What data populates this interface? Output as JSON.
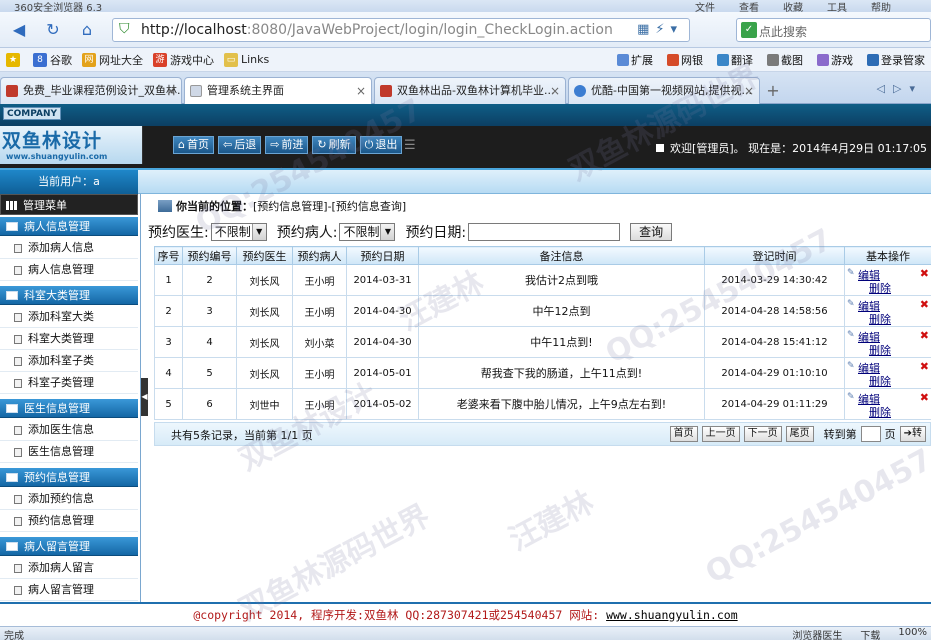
{
  "browser": {
    "title": "360安全浏览器 6.3",
    "menu": [
      "文件",
      "查看",
      "收藏",
      "工具",
      "帮助"
    ],
    "url_host": "http://localhost",
    "url_path": ":8080/JavaWebProject/login/login_CheckLogin.action",
    "search_placeholder": "点此搜索",
    "favorites": [
      {
        "label": "谷歌",
        "color": "#3b6fd1"
      },
      {
        "label": "网址大全",
        "color": "#e3a21b"
      },
      {
        "label": "游戏中心",
        "color": "#d9412a"
      },
      {
        "label": "Links",
        "color": "#e2c04b"
      }
    ],
    "tools": [
      "扩展",
      "网银",
      "翻译",
      "截图",
      "游戏",
      "登录管家"
    ],
    "tabs": [
      {
        "label": "免费_毕业课程范例设计_双鱼林...",
        "color": "#c0392b"
      },
      {
        "label": "管理系统主界面",
        "color": "#cfd8e6"
      },
      {
        "label": "双鱼林出品-双鱼林计算机毕业...",
        "color": "#c0392b"
      },
      {
        "label": "优酷-中国第一视频网站,提供视...",
        "color": "#3c7dd1"
      }
    ],
    "status_left": "完成",
    "status_right": [
      "浏览器医生",
      "下载",
      "100%"
    ]
  },
  "header": {
    "company": "COMPANY",
    "logo_main": "双鱼林设计",
    "logo_sub": "www.shuangyulin.com",
    "buttons": [
      {
        "icon": "⌂",
        "label": "首页"
      },
      {
        "icon": "⇦",
        "label": "后退"
      },
      {
        "icon": "⇨",
        "label": "前进"
      },
      {
        "icon": "↻",
        "label": "刷新"
      },
      {
        "icon": "⏻",
        "label": "退出"
      }
    ],
    "welcome": "欢迎[管理员]。  现在是：2014年4月29日 01:17:05"
  },
  "sidebar": {
    "current_user": "当前用户：a",
    "menu_title": "管理菜单",
    "groups": [
      {
        "title": "病人信息管理",
        "items": [
          "添加病人信息",
          "病人信息管理"
        ]
      },
      {
        "title": "科室大类管理",
        "items": [
          "添加科室大类",
          "科室大类管理",
          "添加科室子类",
          "科室子类管理"
        ]
      },
      {
        "title": "医生信息管理",
        "items": [
          "添加医生信息",
          "医生信息管理"
        ]
      },
      {
        "title": "预约信息管理",
        "items": [
          "添加预约信息",
          "预约信息管理"
        ]
      },
      {
        "title": "病人留言管理",
        "items": [
          "添加病人留言",
          "病人留言管理"
        ]
      }
    ]
  },
  "main": {
    "breadcrumb_label": "你当前的位置：",
    "breadcrumb_path": "[预约信息管理]-[预约信息查询]",
    "filters": {
      "doctor_label": "预约医生:",
      "doctor_value": "不限制",
      "patient_label": "预约病人:",
      "patient_value": "不限制",
      "date_label": "预约日期:",
      "date_value": "",
      "search_button": "查询"
    },
    "columns": [
      "序号",
      "预约编号",
      "预约医生",
      "预约病人",
      "预约日期",
      "备注信息",
      "登记时间",
      "基本操作"
    ],
    "rows": [
      {
        "seq": "1",
        "id": "2",
        "doctor": "刘长风",
        "patient": "王小明",
        "date": "2014-03-31",
        "note": "我估计2点到哦",
        "reg": "2014-03-29 14:30:42"
      },
      {
        "seq": "2",
        "id": "3",
        "doctor": "刘长风",
        "patient": "王小明",
        "date": "2014-04-30",
        "note": "中午12点到",
        "reg": "2014-04-28 14:58:56"
      },
      {
        "seq": "3",
        "id": "4",
        "doctor": "刘长风",
        "patient": "刘小菜",
        "date": "2014-04-30",
        "note": "中午11点到!",
        "reg": "2014-04-28 15:41:12"
      },
      {
        "seq": "4",
        "id": "5",
        "doctor": "刘长风",
        "patient": "王小明",
        "date": "2014-05-01",
        "note": "帮我查下我的肠道，上午11点到!",
        "reg": "2014-04-29 01:10:10"
      },
      {
        "seq": "5",
        "id": "6",
        "doctor": "刘世中",
        "patient": "王小明",
        "date": "2014-05-02",
        "note": "老婆来看下腹中胎儿情况，上午9点左右到!",
        "reg": "2014-04-29 01:11:29"
      }
    ],
    "edit_label": "编辑",
    "delete_label": "删除",
    "pager": {
      "info": "共有5条记录，当前第 1/1 页",
      "first": "首页",
      "prev": "上一页",
      "next": "下一页",
      "last": "尾页",
      "goto_label": "转到第",
      "page_unit": "页",
      "goto_button": "转"
    }
  },
  "footer": {
    "text": "@copyright 2014, 程序开发:双鱼林  QQ:287307421或254540457  网站: ",
    "site": "www.shuangyulin.com"
  },
  "watermarks": [
    "QQ:254540457",
    "双鱼林源码世界",
    "汪建林",
    "QQ:254540457",
    "双鱼林设计",
    "汪建林",
    "QQ:254540457",
    "双鱼林源码世界"
  ]
}
